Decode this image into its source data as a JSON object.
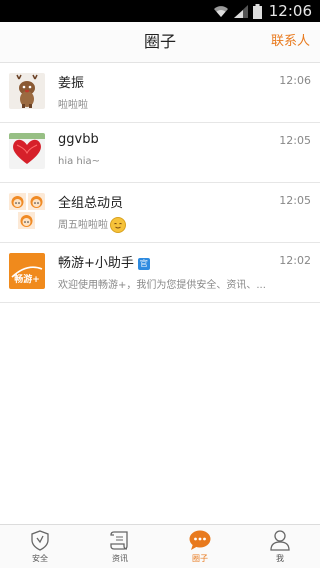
{
  "status_bar": {
    "time": "12:06",
    "icons": [
      "wifi-icon",
      "signal-icon",
      "battery-icon"
    ]
  },
  "header": {
    "title": "圈子",
    "contacts_label": "联系人"
  },
  "conversations": [
    {
      "name": "姜振",
      "message": "啦啦啦",
      "time": "12:06",
      "avatar": "reindeer-avatar"
    },
    {
      "name": "ggvbb",
      "message": "hia hia~",
      "time": "12:05",
      "avatar": "red-heart-avatar"
    },
    {
      "name": "全组总动员",
      "message": "周五啦啦啦",
      "time": "12:05",
      "avatar": "group-cartoon-avatar",
      "emoji": "smiley-emoji"
    },
    {
      "name": "畅游+小助手",
      "badge": "官",
      "message": "欢迎使用畅游+，我们为您提供安全、资讯、...",
      "time": "12:02",
      "avatar": "changyou-logo-avatar",
      "avatar_text": "畅游+"
    }
  ],
  "tabs": [
    {
      "label": "安全",
      "icon": "shield-icon"
    },
    {
      "label": "资讯",
      "icon": "scroll-icon"
    },
    {
      "label": "圈子",
      "icon": "chat-bubble-icon",
      "active": true
    },
    {
      "label": "我",
      "icon": "person-icon"
    }
  ],
  "colors": {
    "accent": "#e87a1e",
    "status_bar": "#000000",
    "badge": "#2f8be0"
  }
}
